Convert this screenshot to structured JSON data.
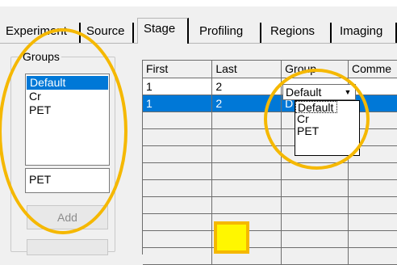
{
  "tabs": [
    {
      "label": "Experiment"
    },
    {
      "label": "Source"
    },
    {
      "label": "Stage",
      "active": true
    },
    {
      "label": "Profiling"
    },
    {
      "label": "Regions"
    },
    {
      "label": "Imaging"
    }
  ],
  "groups": {
    "title": "Groups",
    "items": [
      "Default",
      "Cr",
      "PET"
    ],
    "selected": "Default",
    "name_field": "PET",
    "add_button": "Add"
  },
  "grid": {
    "columns": [
      "First",
      "Last",
      "Group",
      "Comme"
    ],
    "rows": [
      {
        "first": "1",
        "last": "2",
        "group": "Default"
      },
      {
        "first": "1",
        "last": "2",
        "group": "D"
      }
    ],
    "group_dropdown": {
      "value": "Default",
      "options": [
        "Default",
        "Cr",
        "PET"
      ]
    }
  },
  "colors": {
    "selection": "#0078d7",
    "highlight_ring": "#f5b800",
    "highlight_fill": "#fff700"
  }
}
